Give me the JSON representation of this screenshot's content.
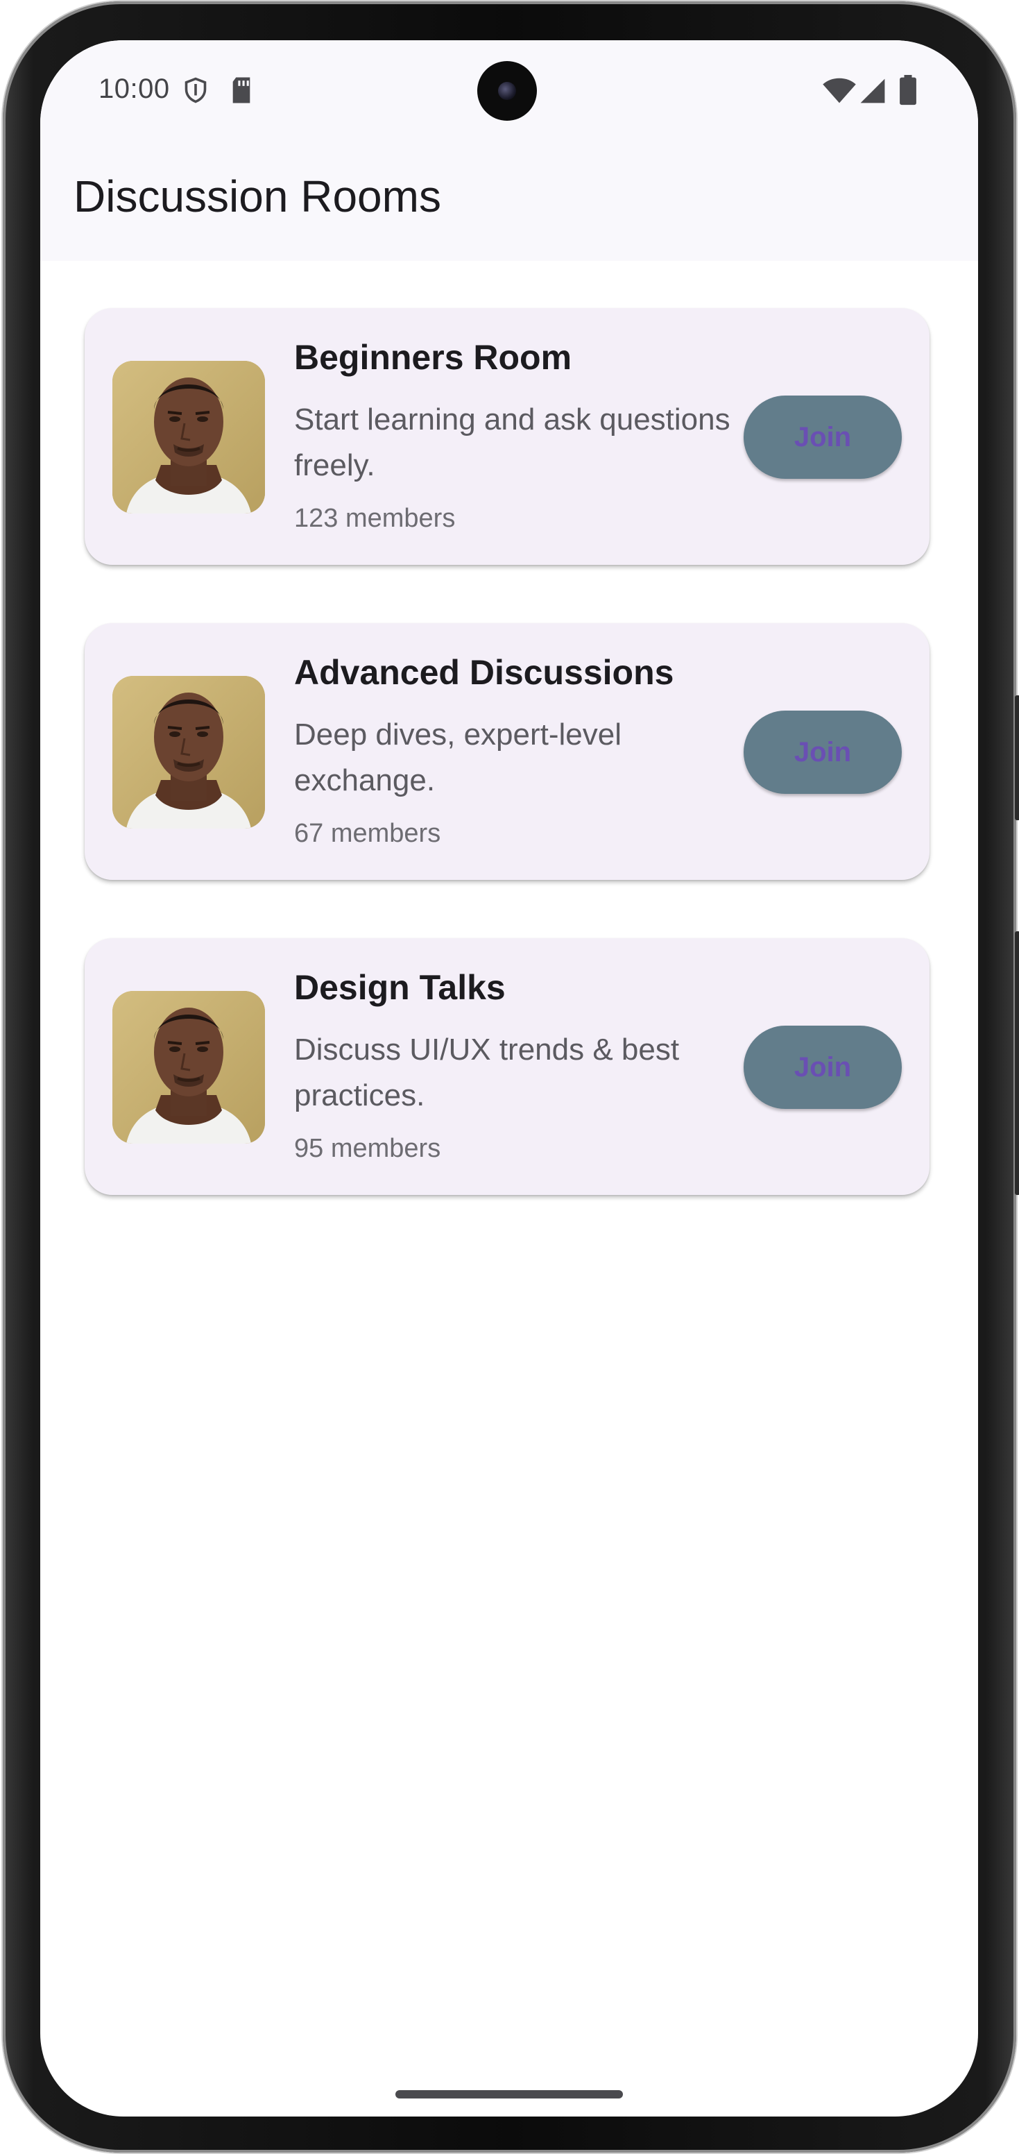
{
  "status_bar": {
    "time": "10:00",
    "icons": [
      "shield-icon",
      "sd-card-icon",
      "wifi-icon",
      "signal-icon",
      "battery-icon"
    ]
  },
  "app_bar": {
    "title": "Discussion Rooms"
  },
  "rooms": [
    {
      "name": "Beginners Room",
      "description": "Start learning and ask questions freely.",
      "members": "123 members",
      "join_label": "Join"
    },
    {
      "name": "Advanced Discussions",
      "description": "Deep dives, expert-level exchange.",
      "members": "67 members",
      "join_label": "Join"
    },
    {
      "name": "Design Talks",
      "description": "Discuss UI/UX trends & best practices.",
      "members": "95 members",
      "join_label": "Join"
    }
  ],
  "colors": {
    "card_background": "#f4eff8",
    "join_button_background": "#627d8b",
    "join_button_text": "#6a4fb3",
    "app_bar_background": "#f9f8fc"
  }
}
